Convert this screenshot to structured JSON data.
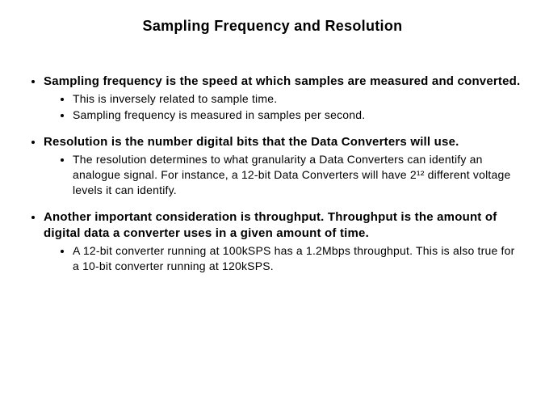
{
  "title": "Sampling Frequency and Resolution",
  "points": [
    {
      "lead": "Sampling frequency is the speed at which samples are measured and converted.",
      "sub": [
        "This is inversely related to sample time.",
        "Sampling frequency is measured in samples per second."
      ]
    },
    {
      "lead": "Resolution is the number digital bits that the Data Converters will use.",
      "sub": [
        "The resolution determines to what granularity a Data Converters can identify an analogue signal. For instance, a 12-bit Data Converters will have 2¹² different voltage levels it can identify."
      ]
    },
    {
      "lead": "Another important consideration is throughput. Throughput is the amount of digital data a converter uses in a given amount of time.",
      "sub": [
        "A 12-bit converter running at 100kSPS has a 1.2Mbps throughput. This is also true for a 10-bit converter running at 120kSPS."
      ]
    }
  ]
}
